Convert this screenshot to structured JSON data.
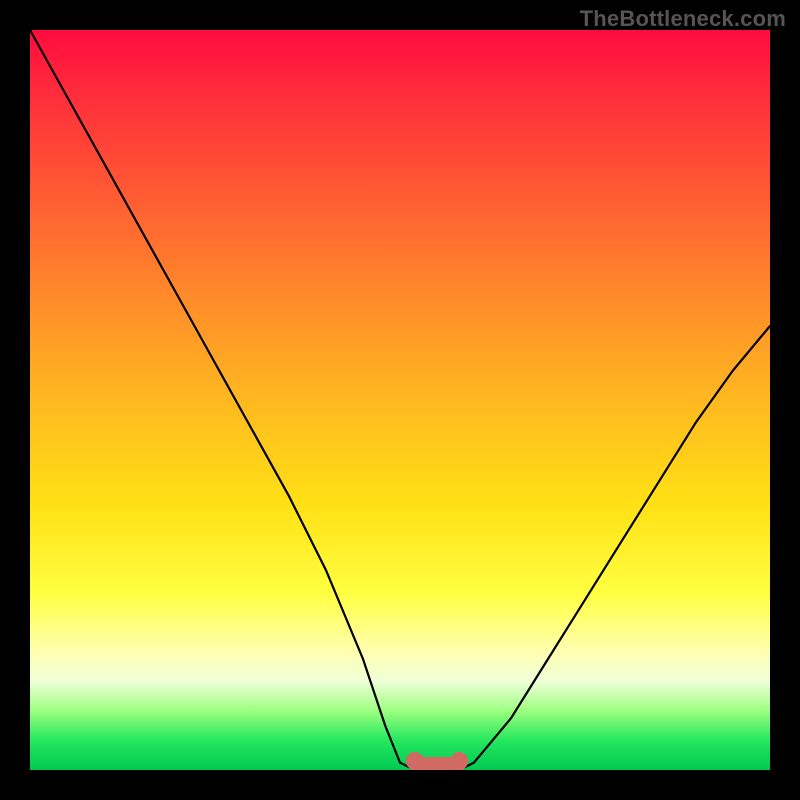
{
  "watermark": "TheBottleneck.com",
  "chart_data": {
    "type": "line",
    "title": "",
    "xlabel": "",
    "ylabel": "",
    "xlim": [
      0,
      100
    ],
    "ylim": [
      0,
      100
    ],
    "x": [
      0,
      5,
      10,
      15,
      20,
      25,
      30,
      35,
      40,
      45,
      48,
      50,
      52,
      54,
      56,
      58,
      60,
      65,
      70,
      75,
      80,
      85,
      90,
      95,
      100
    ],
    "values": [
      100,
      91,
      82,
      73,
      64,
      55,
      46,
      37,
      27,
      15,
      6,
      1,
      0,
      0,
      0,
      0,
      1,
      7,
      15,
      23,
      31,
      39,
      47,
      54,
      60
    ],
    "flat_bottom": {
      "x_start": 52,
      "x_end": 58,
      "y": 0
    },
    "annotations": [],
    "grid": false,
    "legend": null
  },
  "colors": {
    "curve": "#000000",
    "bottom_marker": "#d16a63",
    "frame": "#000000"
  }
}
